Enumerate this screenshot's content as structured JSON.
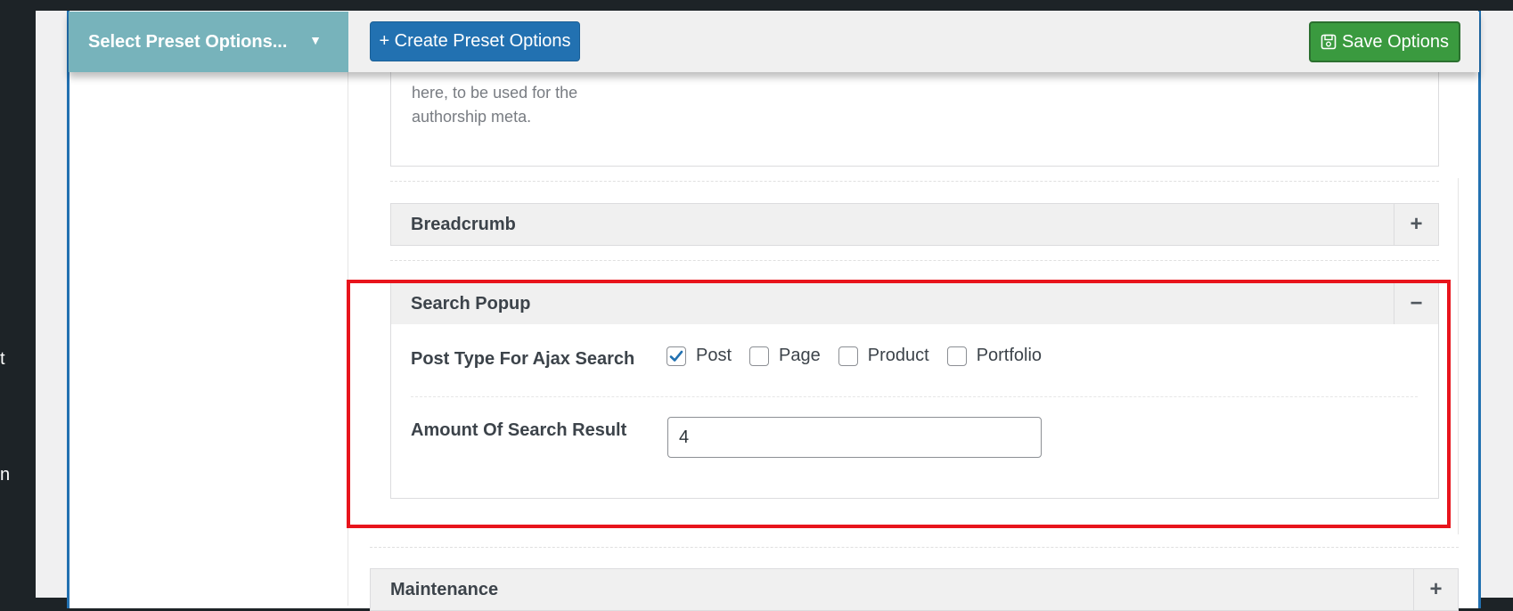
{
  "header": {
    "preset_select_label": "Select Preset Options...",
    "create_button_label": "+ Create Preset Options",
    "save_button_label": "Save Options"
  },
  "author_field": {
    "description": "here, to be used for the authorship meta."
  },
  "sections": {
    "breadcrumb": {
      "title": "Breadcrumb",
      "toggle": "+"
    },
    "search_popup": {
      "title": "Search Popup",
      "toggle": "−",
      "post_type_label": "Post Type For Ajax Search",
      "post_type_options": [
        {
          "label": "Post",
          "checked": true
        },
        {
          "label": "Page",
          "checked": false
        },
        {
          "label": "Product",
          "checked": false
        },
        {
          "label": "Portfolio",
          "checked": false
        }
      ],
      "amount_label": "Amount Of Search Result",
      "amount_value": "4"
    },
    "maintenance": {
      "title": "Maintenance",
      "toggle": "+"
    }
  },
  "left_menu_fragments": [
    "t",
    "n"
  ],
  "colors": {
    "admin_dark": "#1d2327",
    "preset_teal": "#77b3bb",
    "primary_blue": "#2271b1",
    "save_green": "#3a9a3f",
    "highlight_red": "#e8141c",
    "checkbox_blue": "#2271b1"
  }
}
